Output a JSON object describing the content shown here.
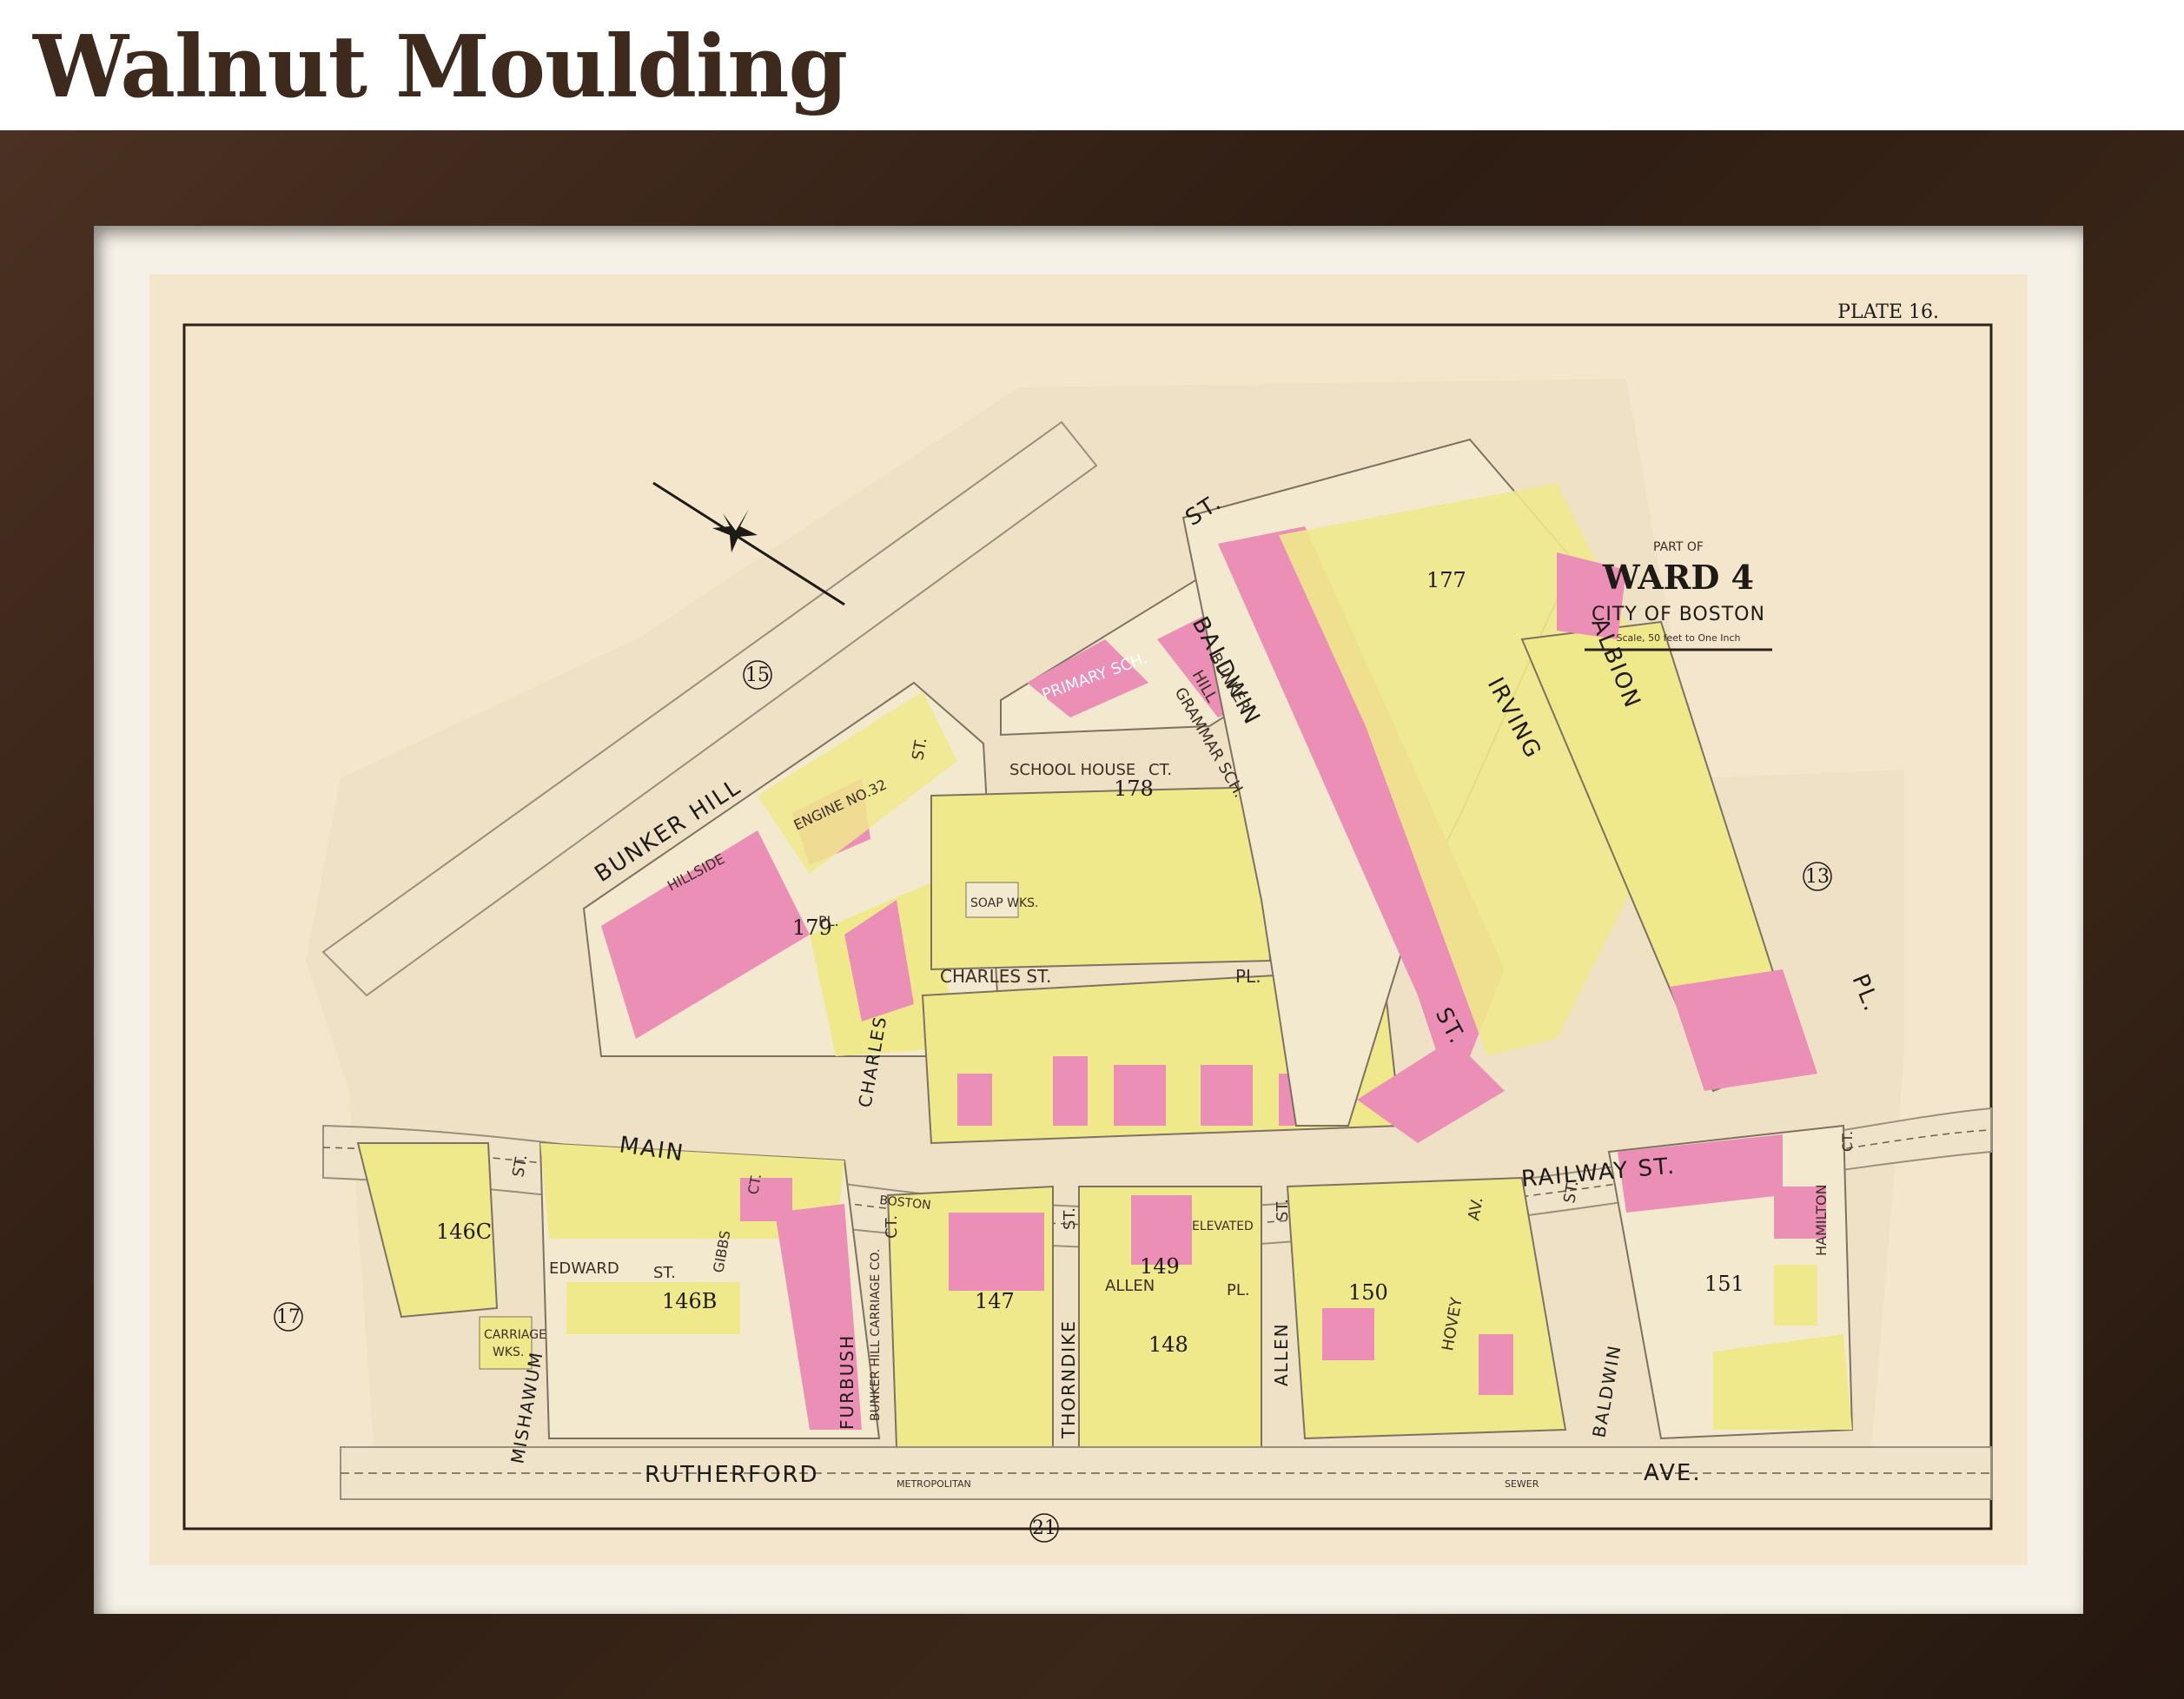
{
  "page_title": "Walnut Moulding",
  "map": {
    "plate": "PLATE 16.",
    "title": {
      "part_of": "PART OF",
      "ward": "WARD 4",
      "city": "CITY OF BOSTON",
      "scale": "Scale, 50 feet to One Inch"
    },
    "streets": {
      "bunker_hill": "BUNKER HILL",
      "bunker_hill_st": "ST.",
      "baldwin_top": "BALDWIN",
      "baldwin_top_st": "ST.",
      "irving": "IRVING",
      "albion": "ALBION",
      "albion_pl": "PL.",
      "school_house_ct": "SCHOOL HOUSE",
      "school_house_ct_end": "CT.",
      "hillside_pl": "HILLSIDE",
      "hillside_pl_end": "PL.",
      "charles_st_vertical": "CHARLES",
      "charles_st_vertical_end": "ST.",
      "charles_st_pl": "CHARLES ST.",
      "charles_st_pl_end": "PL.",
      "main": "MAIN",
      "boston_elevated": "BOSTON",
      "elevated": "ELEVATED",
      "railway_st": "RAILWAY ST.",
      "mishawum": "MISHAWUM",
      "mishawum_st": "ST.",
      "edward_st": "EDWARD",
      "edward_st_end": "ST.",
      "gibbs_ct": "GIBBS",
      "gibbs_ct_end": "CT.",
      "furbush_ct": "FURBUSH",
      "furbush_ct_end": "CT.",
      "thorndike_st": "THORNDIKE",
      "thorndike_st_end": "ST.",
      "allen_pl": "ALLEN",
      "allen_pl_end": "PL.",
      "allen_st": "ALLEN",
      "allen_st_end": "ST.",
      "hovey_av": "HOVEY",
      "hovey_av_end": "AV.",
      "baldwin_bottom": "BALDWIN",
      "baldwin_bottom_st": "ST.",
      "hamilton_ct": "HAMILTON",
      "hamilton_ct_end": "CT.",
      "rutherford": "RUTHERFORD",
      "rutherford_ave": "AVE.",
      "metropolitan": "METROPOLITAN",
      "sewer": "SEWER"
    },
    "landmarks": {
      "primary_sch": "PRIMARY SCH.",
      "grammar_sch_1": "BUNKER",
      "grammar_sch_2": "HILL",
      "grammar_sch_3": "GRAMMAR SCH.",
      "engine_no_32_1": "ENGINE NO.32",
      "soap_wks": "SOAP WKS.",
      "carriage_wks_1": "CARRIAGE",
      "carriage_wks_2": "WKS.",
      "bunker_hill_carriage_co": "BUNKER HILL CARRIAGE CO."
    },
    "plate_refs": [
      "15",
      "13",
      "17",
      "21"
    ],
    "block_numbers": [
      "177",
      "178",
      "179",
      "146C",
      "146B",
      "147",
      "148",
      "149",
      "150",
      "151"
    ],
    "colors": {
      "paper": "#f3e6cc",
      "wood": "#f0e98c",
      "brick": "#ec8fb7",
      "street": "#efe1c6",
      "frame": "#3a2619"
    }
  }
}
